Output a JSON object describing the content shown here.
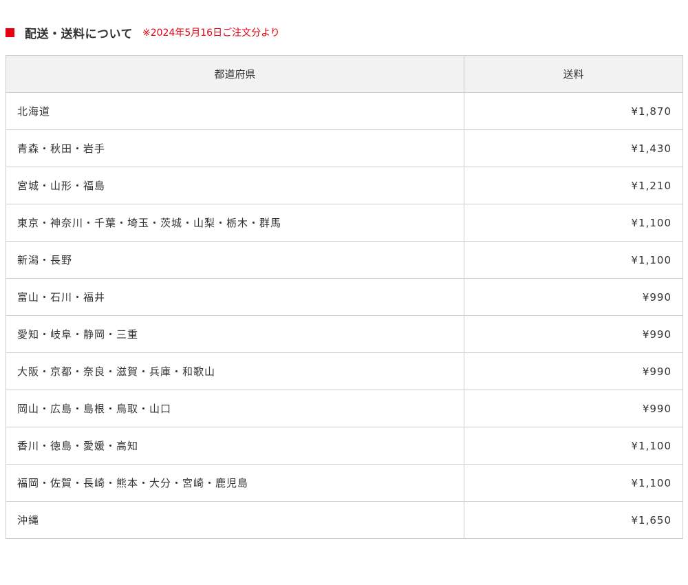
{
  "heading": {
    "title": "配送・送料について",
    "note": "※2024年5月16日ご注文分より",
    "marker_color": "#e60012"
  },
  "table": {
    "headers": {
      "region": "都道府県",
      "fee": "送料"
    },
    "rows": [
      {
        "region": "北海道",
        "fee": "¥1,870"
      },
      {
        "region": "青森・秋田・岩手",
        "fee": "¥1,430"
      },
      {
        "region": "宮城・山形・福島",
        "fee": "¥1,210"
      },
      {
        "region": "東京・神奈川・千葉・埼玉・茨城・山梨・栃木・群馬",
        "fee": "¥1,100"
      },
      {
        "region": "新潟・長野",
        "fee": "¥1,100"
      },
      {
        "region": "富山・石川・福井",
        "fee": "¥990"
      },
      {
        "region": "愛知・岐阜・静岡・三重",
        "fee": "¥990"
      },
      {
        "region": "大阪・京都・奈良・滋賀・兵庫・和歌山",
        "fee": "¥990"
      },
      {
        "region": "岡山・広島・島根・鳥取・山口",
        "fee": "¥990"
      },
      {
        "region": "香川・徳島・愛媛・高知",
        "fee": "¥1,100"
      },
      {
        "region": "福岡・佐賀・長崎・熊本・大分・宮崎・鹿児島",
        "fee": "¥1,100"
      },
      {
        "region": "沖縄",
        "fee": "¥1,650"
      }
    ]
  }
}
